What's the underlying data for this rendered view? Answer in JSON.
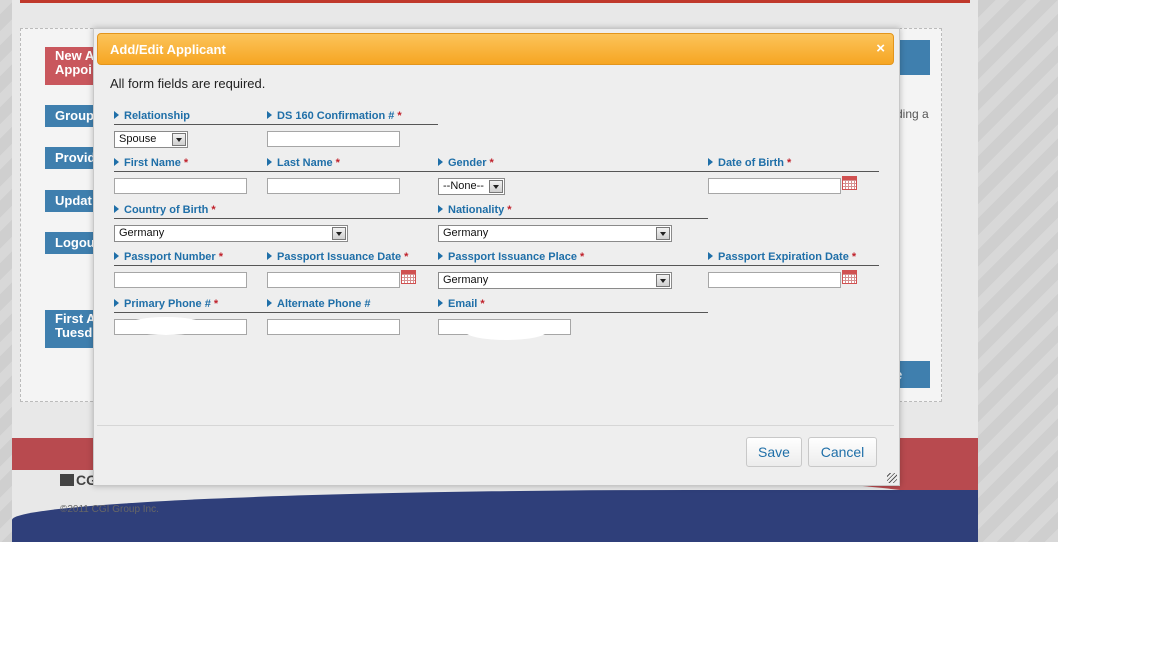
{
  "background": {
    "nav": {
      "new_appointment": "New A\nAppoi",
      "group": "Group",
      "provide": "Provid",
      "update": "Updat",
      "logout": "Logou",
      "first_available": "First A\nTuesd"
    },
    "right_text": "ding a",
    "right_button": "e",
    "cgi_logo": "CGI",
    "copyright": "©2011 CGI Group Inc."
  },
  "modal": {
    "title": "Add/Edit Applicant",
    "close": "×",
    "note": "All form fields are required.",
    "required_marker": "*",
    "fields": {
      "relationship": {
        "label": "Relationship",
        "value": "Spouse"
      },
      "ds160": {
        "label": "DS 160 Confirmation #",
        "value": ""
      },
      "first_name": {
        "label": "First Name",
        "value": ""
      },
      "last_name": {
        "label": "Last Name",
        "value": ""
      },
      "gender": {
        "label": "Gender",
        "value": "--None--"
      },
      "date_of_birth": {
        "label": "Date of Birth",
        "value": ""
      },
      "country_of_birth": {
        "label": "Country of Birth",
        "value": "Germany"
      },
      "nationality": {
        "label": "Nationality",
        "value": "Germany"
      },
      "passport_number": {
        "label": "Passport Number",
        "value": ""
      },
      "passport_issuance_date": {
        "label": "Passport Issuance Date",
        "value": ""
      },
      "passport_issuance_place": {
        "label": "Passport Issuance Place",
        "value": "Germany"
      },
      "passport_expiration_date": {
        "label": "Passport Expiration Date",
        "value": ""
      },
      "primary_phone": {
        "label": "Primary Phone #",
        "value": ""
      },
      "alternate_phone": {
        "label": "Alternate Phone #",
        "value": ""
      },
      "email": {
        "label": "Email",
        "value": ""
      }
    },
    "buttons": {
      "save": "Save",
      "cancel": "Cancel"
    }
  },
  "colors": {
    "header_orange": "#f6a623",
    "label_blue": "#1f6fa8",
    "required_red": "#c0202a",
    "nav_blue": "#3f7fae",
    "nav_red": "#c9575d"
  }
}
